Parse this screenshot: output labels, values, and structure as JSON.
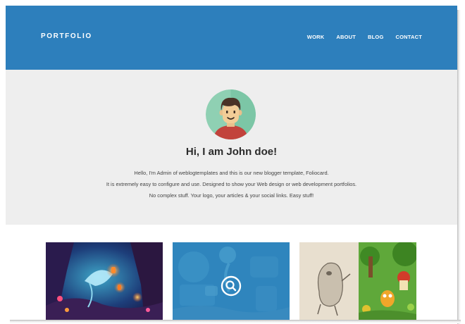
{
  "header": {
    "brand": "PORTFOLIO",
    "nav": [
      "WORK",
      "ABOUT",
      "BLOG",
      "CONTACT"
    ],
    "background": "#2d7fbc"
  },
  "hero": {
    "heading": "Hi, I am John doe!",
    "bio": [
      "Hello, I'm Admin of weblogtemplates and this is our new blogger template, Foliocard.",
      "It is extremely easy to configure and use. Designed to show your Web design or web development portfolios.",
      "No complex stuff. Your logo, your articles & your social links. Easy stuff!"
    ],
    "background": "#eeeeee"
  },
  "gallery": {
    "tiles": [
      {
        "icon": "none"
      },
      {
        "icon": "search-icon"
      },
      {
        "icon": "none"
      }
    ]
  }
}
